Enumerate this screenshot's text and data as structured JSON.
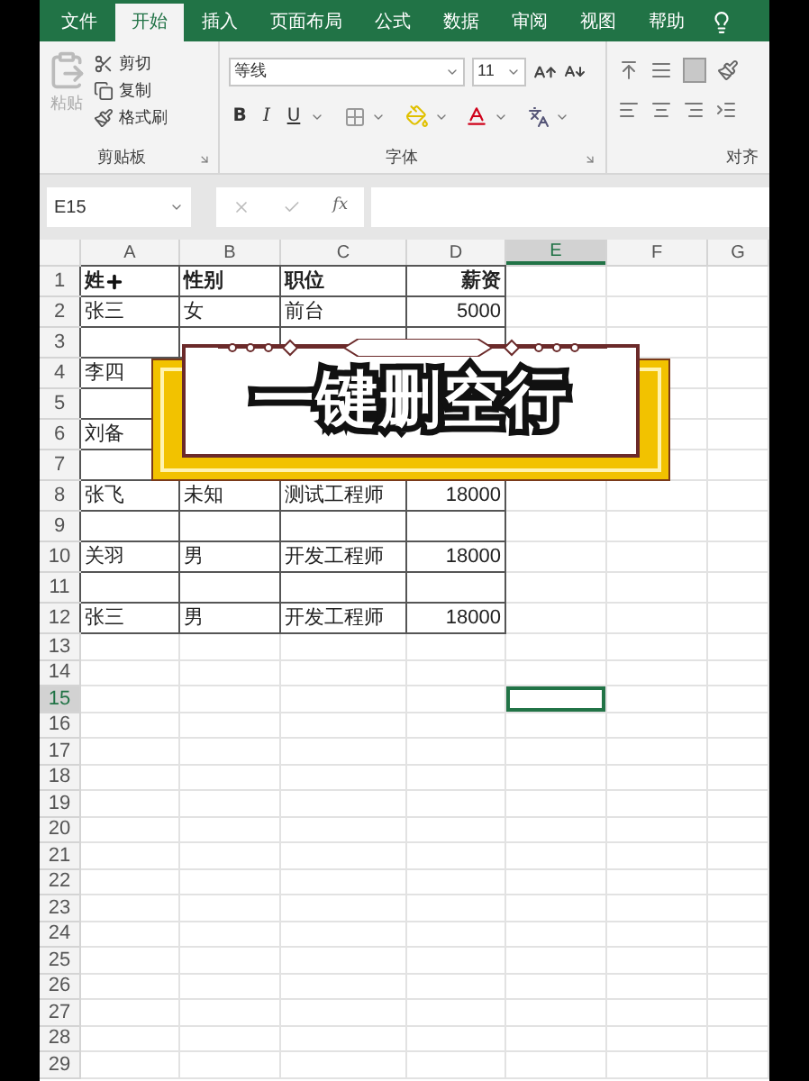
{
  "ribbon": {
    "tabs": [
      {
        "label": "文件",
        "selected": false
      },
      {
        "label": "开始",
        "selected": true
      },
      {
        "label": "插入",
        "selected": false
      },
      {
        "label": "页面布局",
        "selected": false
      },
      {
        "label": "公式",
        "selected": false
      },
      {
        "label": "数据",
        "selected": false
      },
      {
        "label": "审阅",
        "selected": false
      },
      {
        "label": "视图",
        "selected": false
      },
      {
        "label": "帮助",
        "selected": false
      }
    ],
    "clipboard": {
      "label": "剪贴板",
      "paste": {
        "label": "粘贴",
        "disabled": true
      },
      "items": [
        "剪切",
        "复制",
        "格式刷"
      ]
    },
    "font": {
      "label": "字体",
      "font_name": "等线",
      "font_size": "11",
      "bold": "B",
      "italic": "I",
      "underline": "U"
    },
    "alignment": {
      "label": "对齐"
    }
  },
  "formula_bar": {
    "name_box": "E15",
    "function_label": "fx"
  },
  "columns": [
    {
      "label": "A",
      "selected": false
    },
    {
      "label": "B",
      "selected": false
    },
    {
      "label": "C",
      "selected": false
    },
    {
      "label": "D",
      "selected": false
    },
    {
      "label": "E",
      "selected": true
    },
    {
      "label": "F",
      "selected": false
    },
    {
      "label": "G",
      "selected": false
    }
  ],
  "rows": [
    {
      "number": "1",
      "selected": false,
      "kind": "header",
      "cells": [
        "姓",
        "性别",
        "职位",
        "薪资"
      ]
    },
    {
      "number": "2",
      "selected": false,
      "kind": "data",
      "cells": [
        "张三",
        "女",
        "前台",
        "5000"
      ]
    },
    {
      "number": "3",
      "selected": false,
      "kind": "data"
    },
    {
      "number": "4",
      "selected": false,
      "kind": "data",
      "cells": [
        "李四"
      ]
    },
    {
      "number": "5",
      "selected": false,
      "kind": "data"
    },
    {
      "number": "6",
      "selected": false,
      "kind": "data",
      "cells": [
        "刘备"
      ]
    },
    {
      "number": "7",
      "selected": false,
      "kind": "data"
    },
    {
      "number": "8",
      "selected": false,
      "kind": "data",
      "cells": [
        "张飞",
        "未知",
        "测试工程师",
        "18000"
      ]
    },
    {
      "number": "9",
      "selected": false,
      "kind": "data"
    },
    {
      "number": "10",
      "selected": false,
      "kind": "data",
      "cells": [
        "关羽",
        "男",
        "开发工程师",
        "18000"
      ]
    },
    {
      "number": "11",
      "selected": false,
      "kind": "data"
    },
    {
      "number": "12",
      "selected": false,
      "kind": "data",
      "cells": [
        "张三",
        "男",
        "开发工程师",
        "18000"
      ]
    },
    {
      "number": "13",
      "selected": false,
      "kind": "blank"
    },
    {
      "number": "14",
      "selected": false,
      "kind": "blank"
    },
    {
      "number": "15",
      "selected": true,
      "kind": "blank"
    },
    {
      "number": "16",
      "selected": false,
      "kind": "blank"
    },
    {
      "number": "17",
      "selected": false,
      "kind": "blank"
    },
    {
      "number": "18",
      "selected": false,
      "kind": "blank"
    },
    {
      "number": "19",
      "selected": false,
      "kind": "blank"
    },
    {
      "number": "20",
      "selected": false,
      "kind": "blank"
    },
    {
      "number": "21",
      "selected": false,
      "kind": "blank"
    },
    {
      "number": "22",
      "selected": false,
      "kind": "blank"
    },
    {
      "number": "23",
      "selected": false,
      "kind": "blank"
    },
    {
      "number": "24",
      "selected": false,
      "kind": "blank"
    },
    {
      "number": "25",
      "selected": false,
      "kind": "blank"
    },
    {
      "number": "26",
      "selected": false,
      "kind": "blank"
    },
    {
      "number": "27",
      "selected": false,
      "kind": "blank"
    },
    {
      "number": "28",
      "selected": false,
      "kind": "blank"
    },
    {
      "number": "29",
      "selected": false,
      "kind": "blank"
    }
  ],
  "banner": {
    "text": "一键删空行"
  }
}
